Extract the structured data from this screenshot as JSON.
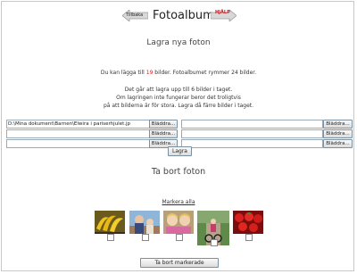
{
  "header": {
    "back_label": "Tillbaka",
    "title": "Fotoalbum",
    "help_label": "HJÄLP"
  },
  "upload_section": {
    "heading": "Lagra nya foton",
    "info1_prefix": "Du kan lägga till ",
    "info1_count": "19",
    "info1_suffix": " bilder. Fotoalbumet rymmer 24 bilder.",
    "info2_line1": "Det går att lagra upp till 6 bilder i taget.",
    "info2_line2": "Om lagringen inte fungerar beror det troligtvis",
    "info2_line3": "på att bilderna är för stora. Lagra då färre bilder i taget.",
    "file_values": [
      "D:\\Mina dokument\\Barnen\\Elwira i pariserhjulet.jp",
      "",
      "",
      "",
      "",
      ""
    ],
    "browse_label": "Bläddra...",
    "save_label": "Lagra"
  },
  "delete_section": {
    "heading": "Ta bort foton",
    "select_all_label": "Markera alla",
    "delete_label": "Ta bort markerade",
    "photos": [
      {
        "name": "bananas"
      },
      {
        "name": "boy-and-toddler"
      },
      {
        "name": "two-girls"
      },
      {
        "name": "child-on-bike"
      },
      {
        "name": "strawberries"
      }
    ]
  }
}
